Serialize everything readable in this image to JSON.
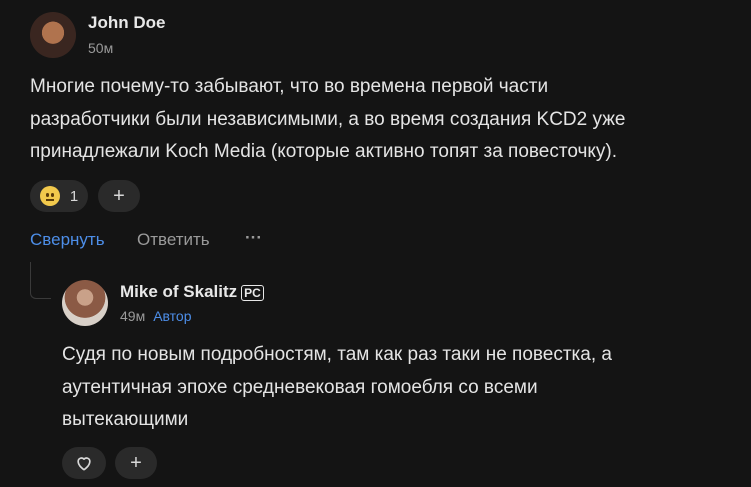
{
  "comment": {
    "author": "John Doe",
    "time": "50м",
    "text_lines": [
      "Многие почему-то забывают, что во времена первой части",
      "разработчики были независимыми, а во время создания KCD2 уже",
      "принадлежали Koch Media (которые активно топят за повесточку)."
    ],
    "reaction_count": "1",
    "add_reaction": "+",
    "collapse_label": "Свернуть",
    "reply_label": "Ответить",
    "more_label": "···"
  },
  "reply": {
    "author": "Mike of Skalitz",
    "platform_badge": "PC",
    "time": "49м",
    "author_badge": "Автор",
    "text_lines": [
      "Судя по новым подробностям, там как раз таки не повестка, а",
      "аутентичная эпохе средневековая гомоебля со всеми",
      "вытекающими"
    ],
    "add_reaction": "+"
  },
  "colors": {
    "accent": "#4d8ee8",
    "background": "#141414",
    "pill": "#2a2a2a"
  },
  "icons": [
    "neutral-face-emoji-icon",
    "heart-icon",
    "plus-icon",
    "more-icon"
  ]
}
